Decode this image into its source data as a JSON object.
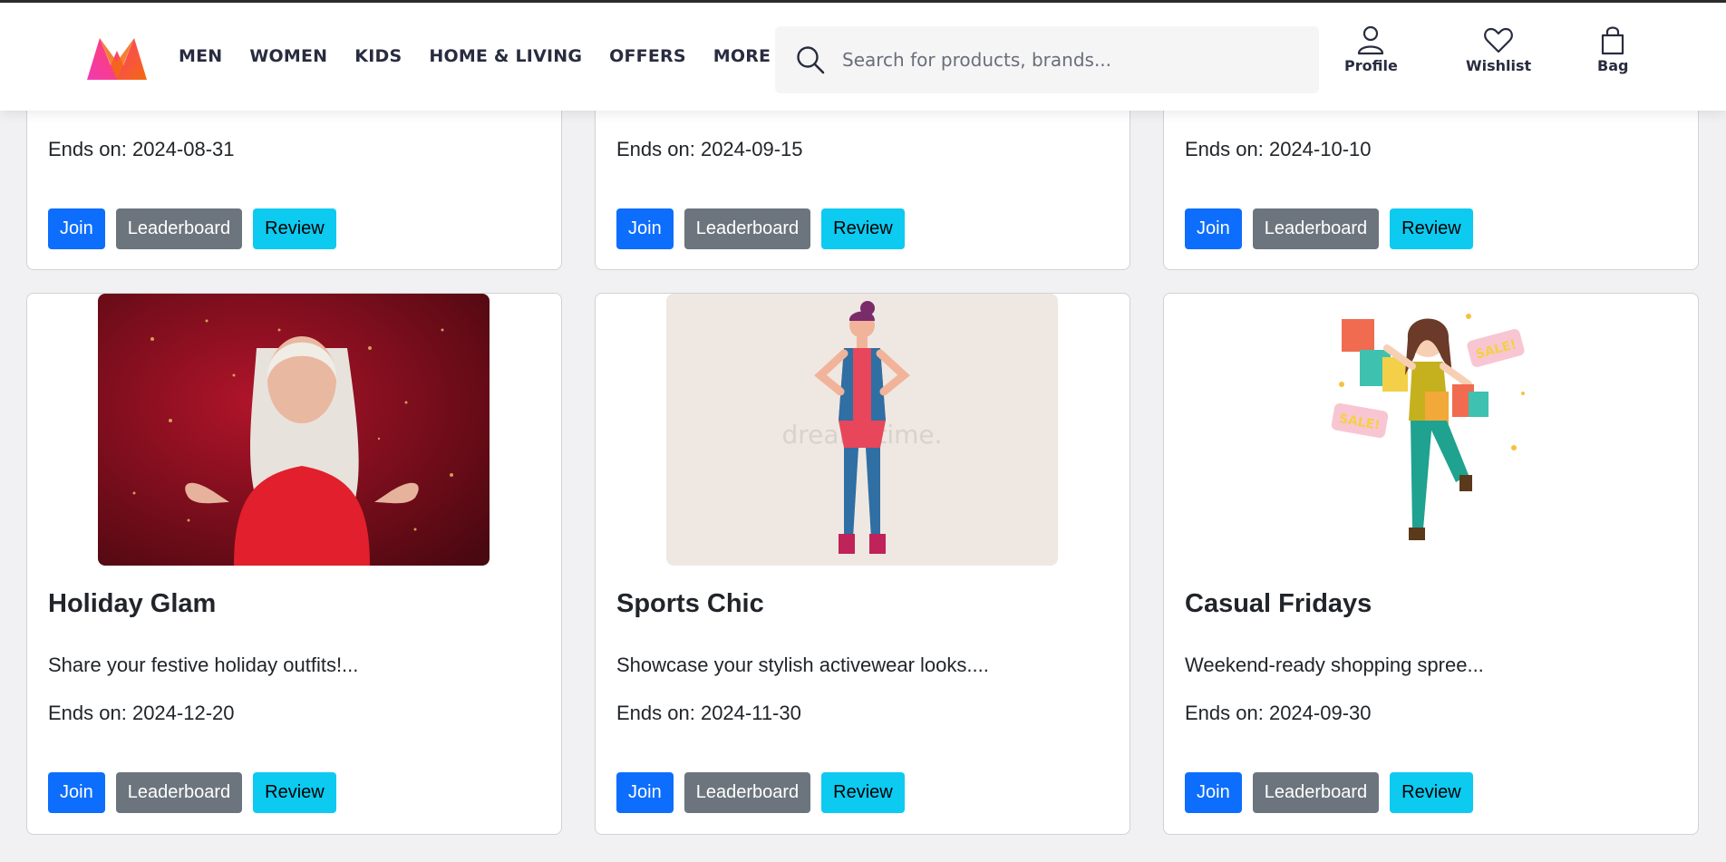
{
  "header": {
    "nav": [
      "MEN",
      "WOMEN",
      "KIDS",
      "HOME & LIVING",
      "OFFERS",
      "MORE"
    ],
    "search_placeholder": "Search for products, brands...",
    "actions": {
      "profile": "Profile",
      "wishlist": "Wishlist",
      "bag": "Bag"
    }
  },
  "buttons": {
    "join": "Join",
    "leaderboard": "Leaderboard",
    "review": "Review"
  },
  "top_cards": [
    {
      "ends": "Ends on: 2024-08-31"
    },
    {
      "ends": "Ends on: 2024-09-15"
    },
    {
      "ends": "Ends on: 2024-10-10"
    }
  ],
  "cards": [
    {
      "title": "Holiday Glam",
      "desc": "Share your festive holiday outfits!...",
      "ends": "Ends on: 2024-12-20"
    },
    {
      "title": "Sports Chic",
      "desc": "Showcase your stylish activewear looks....",
      "ends": "Ends on: 2024-11-30"
    },
    {
      "title": "Casual Fridays",
      "desc": "Weekend-ready shopping spree...",
      "ends": "Ends on: 2024-09-30"
    }
  ],
  "images": {
    "watermark": "dreamstime.",
    "sale_tag": "SALE!"
  },
  "colors": {
    "join": "#0d6efd",
    "leaderboard": "#6c757d",
    "review": "#0dcaf0",
    "logo_pink": "#ff3f6c",
    "logo_orange": "#f26a10"
  }
}
